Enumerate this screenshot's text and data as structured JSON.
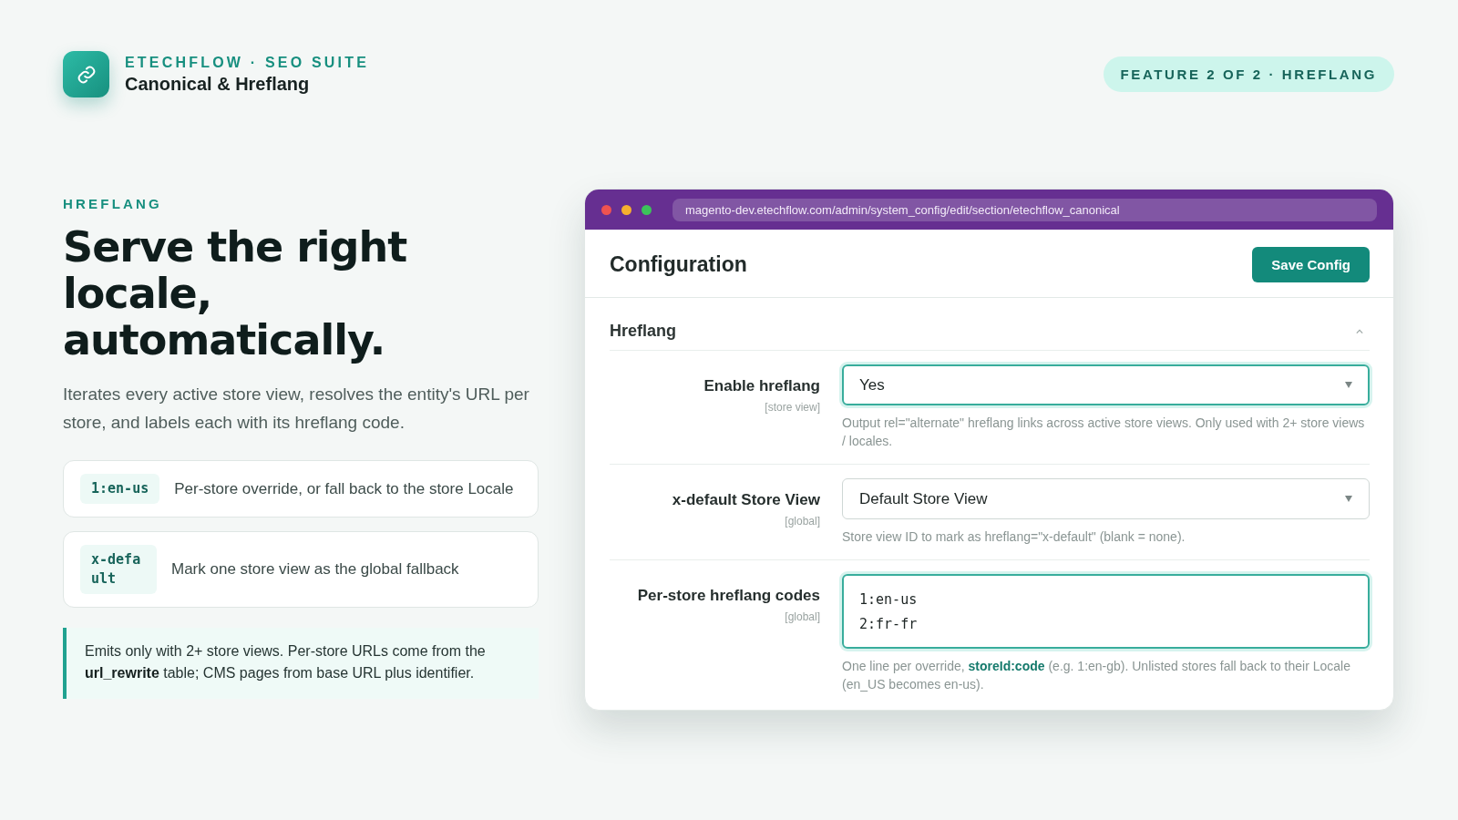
{
  "brand": {
    "eyebrow": "ETECHFLOW · SEO SUITE",
    "title": "Canonical & Hreflang"
  },
  "feature_badge": "FEATURE 2 OF 2 · HREFLANG",
  "intro": {
    "eyebrow": "HREFLANG",
    "headline": [
      "Serve the right",
      "locale,",
      "automatically."
    ],
    "body": "Iterates every active store view, resolves the entity's URL per store, and labels each with its hreflang code."
  },
  "points": [
    {
      "code": "1:en-us",
      "text": "Per-store override, or fall back to the store Locale"
    },
    {
      "code": "x-default",
      "text": "Mark one store view as the global fallback"
    }
  ],
  "note": "Emits only with 2+ store views. Per-store URLs come from the **url_rewrite** table; CMS pages from base URL plus identifier.",
  "browser": {
    "url": "magento-dev.etechflow.com/admin/system_config/edit/section/etechflow_canonical",
    "page_title": "Configuration",
    "save_button": "Save Config",
    "section": {
      "title": "Hreflang",
      "expanded": true,
      "fields": [
        {
          "kind": "select",
          "label": "Enable hreflang",
          "scope": "[store view]",
          "value": "Yes",
          "focused": true,
          "hint": "Output rel=\"alternate\" hreflang links across active store views. Only used with 2+ store views / locales."
        },
        {
          "kind": "select",
          "label": "x-default Store View",
          "scope": "[global]",
          "value": "Default Store View",
          "focused": false,
          "hint": "Store view ID to mark as hreflang=\"x-default\" (blank = none)."
        },
        {
          "kind": "textarea",
          "label": "Per-store hreflang codes",
          "scope": "[global]",
          "lines": [
            "1:en-us",
            "2:fr-fr"
          ],
          "focused": true,
          "hint": "One line per override, **storeId:code** (e.g. 1:en-gb). Unlisted stores fall back to their Locale (en_US becomes en-us)."
        }
      ]
    }
  }
}
